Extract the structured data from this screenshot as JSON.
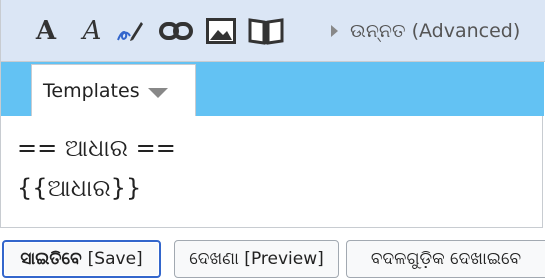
{
  "toolbar": {
    "bold_label": "A",
    "italic_label": "A",
    "advanced_label": "ଉନ୍ନତ (Advanced)",
    "icons": [
      "signature-icon",
      "link-icon",
      "image-icon",
      "book-icon"
    ]
  },
  "tabs": {
    "templates_label": "Templates"
  },
  "editor": {
    "content": "== ଆଧାର ==\n{{ଆଧାର}}"
  },
  "buttons": {
    "save_bold": "ସାଇତିବେ",
    "save_plain": "[Save]",
    "preview": "ଦେଖଣା [Preview]",
    "diff": "ବଦଳଗୁଡ଼ିକ ଦେଖାଇବେ"
  },
  "colors": {
    "toolbar_bg": "#dbe6f5",
    "tabrow_bg": "#63c2f3",
    "save_border": "#3366cc"
  }
}
